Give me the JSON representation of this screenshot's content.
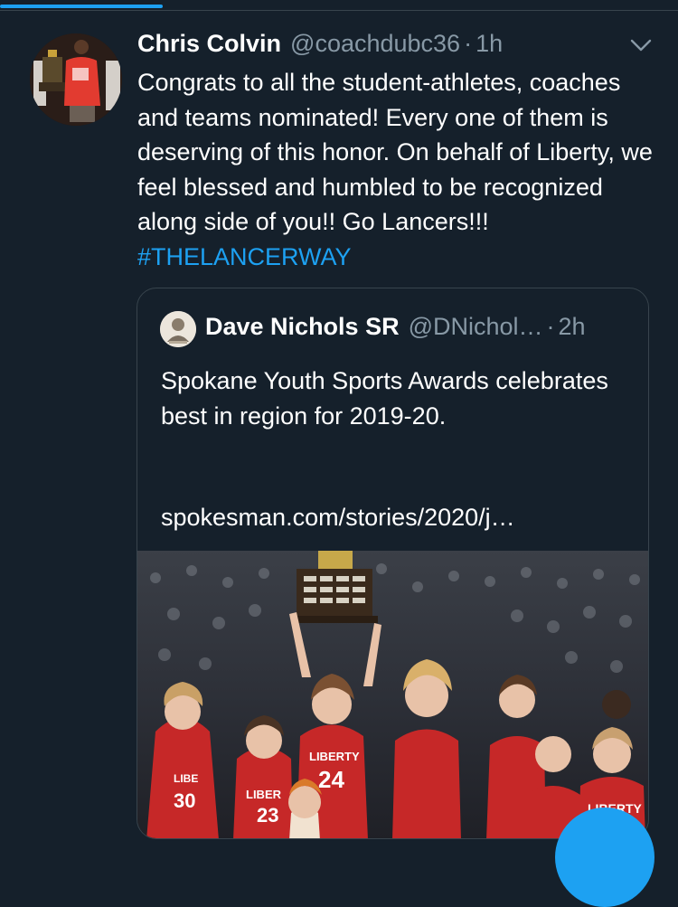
{
  "progress": {
    "value": 0.24,
    "color": "#1da1f2"
  },
  "tweet": {
    "author": {
      "display_name": "Chris Colvin",
      "handle": "@coachdubc36"
    },
    "separator": "·",
    "time": "1h",
    "text_main": "Congrats to all the student-athletes, coaches and teams nominated! Every one of them is deserving of this honor. On behalf of Liberty, we feel blessed and humbled to be recognized along side of you!! Go Lancers!!! ",
    "hashtag": "#THELANCERWAY",
    "menu_icon": "chevron-down-icon"
  },
  "quote": {
    "author": {
      "display_name": "Dave Nichols SR",
      "handle": "@DNichol…"
    },
    "separator": "·",
    "time": "2h",
    "text": "Spokane Youth Sports Awards celebrates best in region for 2019-20.",
    "link": "spokesman.com/stories/2020/j…",
    "image_alt": "liberty-girls-basketball-trophy-celebration",
    "jersey_labels": [
      "LIBERTY",
      "24",
      "LIBER",
      "23",
      "LIBERTY",
      "LIBE",
      "30",
      "LIBERTY"
    ]
  },
  "colors": {
    "background": "#15202b",
    "border": "#38444d",
    "secondary_text": "#8899a6",
    "accent": "#1da1f2",
    "jersey_red": "#d62a2a"
  }
}
